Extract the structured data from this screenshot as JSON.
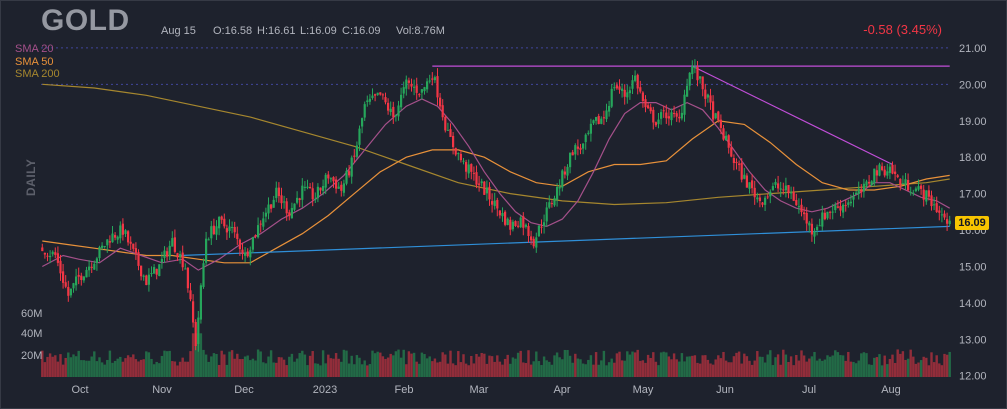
{
  "header": {
    "ticker": "GOLD",
    "date": "Aug 15",
    "open": "O:16.58",
    "high": "H:16.61",
    "low": "L:16.09",
    "close": "C:16.09",
    "volume": "Vol:8.76M",
    "change": "-0.58 (3.45%)",
    "timeframe": "DAILY"
  },
  "legend": [
    {
      "label": "SMA 20",
      "color": "#a4508a"
    },
    {
      "label": "SMA 50",
      "color": "#e8913a"
    },
    {
      "label": "SMA 200",
      "color": "#a6872e"
    }
  ],
  "colors": {
    "up": "#26a65b",
    "down": "#f23645",
    "background": "#1e222d",
    "support_line": "#2f8fd8",
    "resistance_line": "#c14ed8",
    "price_tag": "#f7c400"
  },
  "chart_data": {
    "type": "candlestick",
    "title": "GOLD",
    "y_axis": {
      "ticks": [
        "21.00",
        "20.00",
        "19.00",
        "18.00",
        "17.00",
        "16.00",
        "15.00",
        "14.00",
        "13.00",
        "12.00"
      ],
      "range": [
        11.8,
        21.3
      ]
    },
    "x_axis": {
      "ticks": [
        "Oct",
        "Nov",
        "Dec",
        "2023",
        "Feb",
        "Mar",
        "Apr",
        "May",
        "Jun",
        "Jul",
        "Aug"
      ]
    },
    "volume_axis": {
      "ticks": [
        "60M",
        "40M",
        "20M"
      ]
    },
    "last_price": "16.09",
    "horizontal_lines": [
      {
        "price": 20.0,
        "style": "dotted"
      },
      {
        "price": 21.0,
        "style": "dotted"
      }
    ],
    "price_path": [
      [
        0,
        15.5
      ],
      [
        5,
        15.3
      ],
      [
        10,
        14.2
      ],
      [
        14,
        14.7
      ],
      [
        20,
        15.2
      ],
      [
        26,
        15.8
      ],
      [
        31,
        16.0
      ],
      [
        36,
        15.2
      ],
      [
        40,
        14.6
      ],
      [
        45,
        15.0
      ],
      [
        50,
        15.7
      ],
      [
        55,
        15.0
      ],
      [
        59,
        12.9
      ],
      [
        63,
        15.8
      ],
      [
        68,
        16.2
      ],
      [
        73,
        16.0
      ],
      [
        78,
        15.3
      ],
      [
        85,
        16.4
      ],
      [
        90,
        17.0
      ],
      [
        95,
        16.5
      ],
      [
        100,
        17.1
      ],
      [
        105,
        16.9
      ],
      [
        110,
        17.5
      ],
      [
        115,
        17.1
      ],
      [
        120,
        18.0
      ],
      [
        124,
        19.4
      ],
      [
        130,
        19.7
      ],
      [
        135,
        19.1
      ],
      [
        140,
        20.0
      ],
      [
        146,
        19.8
      ],
      [
        150,
        20.3
      ],
      [
        152,
        19.8
      ],
      [
        156,
        18.6
      ],
      [
        162,
        17.8
      ],
      [
        168,
        17.3
      ],
      [
        174,
        16.7
      ],
      [
        180,
        16.1
      ],
      [
        184,
        16.3
      ],
      [
        189,
        15.7
      ],
      [
        194,
        16.5
      ],
      [
        198,
        17.1
      ],
      [
        204,
        18.2
      ],
      [
        208,
        18.3
      ],
      [
        212,
        18.9
      ],
      [
        216,
        19.1
      ],
      [
        220,
        20.0
      ],
      [
        224,
        19.7
      ],
      [
        228,
        20.2
      ],
      [
        232,
        19.3
      ],
      [
        236,
        19.0
      ],
      [
        240,
        19.2
      ],
      [
        245,
        19.0
      ],
      [
        248,
        20.1
      ],
      [
        250,
        20.5
      ],
      [
        254,
        19.9
      ],
      [
        258,
        19.2
      ],
      [
        262,
        18.6
      ],
      [
        266,
        17.9
      ],
      [
        270,
        17.4
      ],
      [
        276,
        16.8
      ],
      [
        282,
        17.2
      ],
      [
        288,
        17.0
      ],
      [
        292,
        16.5
      ],
      [
        296,
        16.0
      ],
      [
        302,
        16.5
      ],
      [
        308,
        16.7
      ],
      [
        312,
        16.9
      ],
      [
        316,
        17.1
      ],
      [
        320,
        17.6
      ],
      [
        326,
        17.7
      ],
      [
        330,
        17.3
      ],
      [
        334,
        17.2
      ],
      [
        339,
        17.0
      ],
      [
        343,
        16.7
      ],
      [
        346,
        16.4
      ],
      [
        349,
        16.1
      ]
    ],
    "sma_20": [
      [
        0,
        15.0
      ],
      [
        8,
        15.3
      ],
      [
        14,
        15.2
      ],
      [
        22,
        15.1
      ],
      [
        30,
        15.5
      ],
      [
        38,
        15.3
      ],
      [
        46,
        15.1
      ],
      [
        54,
        15.2
      ],
      [
        60,
        14.9
      ],
      [
        68,
        15.2
      ],
      [
        76,
        15.6
      ],
      [
        84,
        15.9
      ],
      [
        92,
        16.3
      ],
      [
        100,
        16.6
      ],
      [
        108,
        17.0
      ],
      [
        116,
        17.5
      ],
      [
        124,
        18.2
      ],
      [
        132,
        18.9
      ],
      [
        140,
        19.4
      ],
      [
        146,
        19.6
      ],
      [
        152,
        19.4
      ],
      [
        158,
        18.9
      ],
      [
        164,
        18.3
      ],
      [
        170,
        17.6
      ],
      [
        176,
        17.0
      ],
      [
        182,
        16.5
      ],
      [
        188,
        16.2
      ],
      [
        194,
        16.1
      ],
      [
        200,
        16.3
      ],
      [
        206,
        16.8
      ],
      [
        212,
        17.6
      ],
      [
        218,
        18.5
      ],
      [
        224,
        19.2
      ],
      [
        230,
        19.5
      ],
      [
        236,
        19.5
      ],
      [
        242,
        19.3
      ],
      [
        248,
        19.5
      ],
      [
        254,
        19.3
      ],
      [
        260,
        18.8
      ],
      [
        266,
        18.2
      ],
      [
        272,
        17.6
      ],
      [
        278,
        17.1
      ],
      [
        284,
        16.8
      ],
      [
        290,
        16.6
      ],
      [
        296,
        16.5
      ],
      [
        302,
        16.6
      ],
      [
        308,
        16.8
      ],
      [
        314,
        17.0
      ],
      [
        320,
        17.3
      ],
      [
        326,
        17.3
      ],
      [
        332,
        17.1
      ],
      [
        338,
        16.9
      ],
      [
        344,
        16.8
      ],
      [
        349,
        16.6
      ]
    ],
    "sma_50": [
      [
        0,
        15.7
      ],
      [
        10,
        15.6
      ],
      [
        20,
        15.5
      ],
      [
        30,
        15.4
      ],
      [
        40,
        15.3
      ],
      [
        50,
        15.3
      ],
      [
        60,
        15.2
      ],
      [
        70,
        15.1
      ],
      [
        80,
        15.1
      ],
      [
        90,
        15.5
      ],
      [
        100,
        15.9
      ],
      [
        110,
        16.4
      ],
      [
        120,
        17.0
      ],
      [
        130,
        17.6
      ],
      [
        140,
        18.0
      ],
      [
        150,
        18.2
      ],
      [
        160,
        18.2
      ],
      [
        170,
        18.0
      ],
      [
        180,
        17.6
      ],
      [
        190,
        17.3
      ],
      [
        200,
        17.2
      ],
      [
        210,
        17.6
      ],
      [
        220,
        17.8
      ],
      [
        230,
        17.8
      ],
      [
        240,
        17.9
      ],
      [
        250,
        18.5
      ],
      [
        260,
        19.0
      ],
      [
        270,
        18.9
      ],
      [
        280,
        18.4
      ],
      [
        290,
        17.8
      ],
      [
        300,
        17.3
      ],
      [
        310,
        17.1
      ],
      [
        320,
        17.1
      ],
      [
        330,
        17.2
      ],
      [
        340,
        17.4
      ],
      [
        349,
        17.5
      ]
    ],
    "sma_200": [
      [
        0,
        20.0
      ],
      [
        20,
        19.9
      ],
      [
        40,
        19.7
      ],
      [
        60,
        19.4
      ],
      [
        80,
        19.1
      ],
      [
        100,
        18.7
      ],
      [
        120,
        18.3
      ],
      [
        140,
        17.8
      ],
      [
        160,
        17.3
      ],
      [
        180,
        17.0
      ],
      [
        200,
        16.8
      ],
      [
        220,
        16.7
      ],
      [
        240,
        16.75
      ],
      [
        260,
        16.9
      ],
      [
        280,
        17.0
      ],
      [
        300,
        17.1
      ],
      [
        320,
        17.2
      ],
      [
        340,
        17.3
      ],
      [
        349,
        17.4
      ]
    ]
  }
}
